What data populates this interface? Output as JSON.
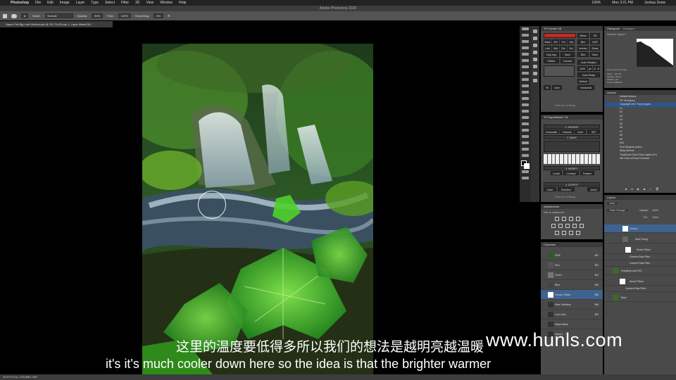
{
  "menubar": {
    "app": "Photoshop",
    "items": [
      "File",
      "Edit",
      "Image",
      "Layer",
      "Type",
      "Select",
      "Filter",
      "3D",
      "View",
      "Window",
      "Help"
    ],
    "battery": "100%",
    "clock": "Mon 3:21 PM",
    "user": "Joshua Snow"
  },
  "window_title": "Adobe Photoshop 2020",
  "options": {
    "mode_label": "Mode:",
    "mode_value": "Normal",
    "opacity_label": "Opacity:",
    "opacity_value": "80%",
    "flow_label": "Flow:",
    "flow_value": "100%",
    "smoothing_label": "Smoothing:",
    "smoothing_value": "0%"
  },
  "document_tab": "Upper Fall Big Leaf Vertical.psb @ 26.7% (Group 1, Layer Mask/16) *",
  "tk_panel": {
    "title": "TK Combo V8",
    "buttons": [
      "Mask",
      "Sel",
      "Col",
      "Adj",
      "Lum",
      "Mid",
      "Drk",
      "Dsl",
      "Blur",
      "Inverse",
      "Dup Img",
      "Save",
      "Flatten",
      "Convert",
      "Auto Sharpen",
      "Zone Sharp",
      "Vertical",
      "Horizontal",
      "TK",
      "User",
      "Blend",
      "Fill",
      "ACR",
      "Sharp",
      "Blur",
      "Save"
    ],
    "click_settings": "Click for settings",
    "value_1200": "1200",
    "value_px": "px",
    "value_20": "20",
    "value_40": "40"
  },
  "tk_panel2": {
    "title": "TK RapidMask2 V8",
    "source": "1. SOURCE",
    "composite": "Composite",
    "channel": "Channel",
    "color": "Color",
    "sat": "SAT",
    "mask": "2. MASK",
    "modify": "3. MODIFY",
    "levels": "Levels",
    "contract": "Contract",
    "feather": "Feather",
    "output": "4. OUTPUT",
    "layer": "Layer",
    "selection": "Selection",
    "apply": "Apply",
    "click_settings": "Click for settings"
  },
  "histogram": {
    "tabs": [
      "Histogram",
      "Navigator"
    ],
    "channel": "Channel: Alpha 1",
    "source": "Source: Entire Image",
    "stats": "Mean:   101.33\nStd Dev: 68.34\nMedian: 110\nPixels: 2580378"
  },
  "actions": {
    "title": "Actions",
    "items": [
      "Default Actions",
      "TK V8 Actions",
      "Copyright 2017 Tony Kuyper",
      "#1",
      "#2",
      "#3",
      "#4",
      "#5",
      "#6",
      "#7",
      "#8",
      "#9",
      "#10",
      "Post Sharpen Action",
      "Wrap Actions",
      "Traditional Orton Glow Lights (Pro",
      "Hilt Orton w/Tonal Contrast"
    ]
  },
  "layers": {
    "title": "Layers",
    "kind": "Kind",
    "blend": "Pass Through",
    "opacity_label": "Opacity:",
    "opacity_value": "100%",
    "fill_label": "Fill:",
    "fill_value": "100%",
    "rows": [
      "Group 1",
      "Split Toning",
      "Smart Filters",
      "Camera Raw Filter",
      "Camera Raw Filter",
      "Gradients and HSL",
      "Smart Filters",
      "Camera Raw Filter",
      "Base"
    ]
  },
  "adjustments": {
    "title": "Adjustments",
    "subtitle": "Add an adjustment"
  },
  "channels": {
    "title": "Channels",
    "rows": [
      {
        "name": "RGB",
        "key": "⌘2"
      },
      {
        "name": "Red",
        "key": "⌘3"
      },
      {
        "name": "Green",
        "key": "⌘4"
      },
      {
        "name": "Blue",
        "key": "⌘5"
      },
      {
        "name": "Group 1 Mask",
        "key": "⌘6"
      },
      {
        "name": "Hear Selection",
        "key": "⌘8"
      },
      {
        "name": "Lum Lone",
        "key": "⌘9"
      },
      {
        "name": "Rapid Mask",
        "key": ""
      },
      {
        "name": "Alpha 1",
        "key": ""
      }
    ]
  },
  "statusbar": "26.67%   Doc: 378.8M/1.35G",
  "subtitle_cn": "这里的温度要低得多所以我们的想法是越明亮越温暖",
  "subtitle_en": "it's it's much cooler down here so the idea is that the brighter warmer",
  "watermark": "www.hunls.com"
}
